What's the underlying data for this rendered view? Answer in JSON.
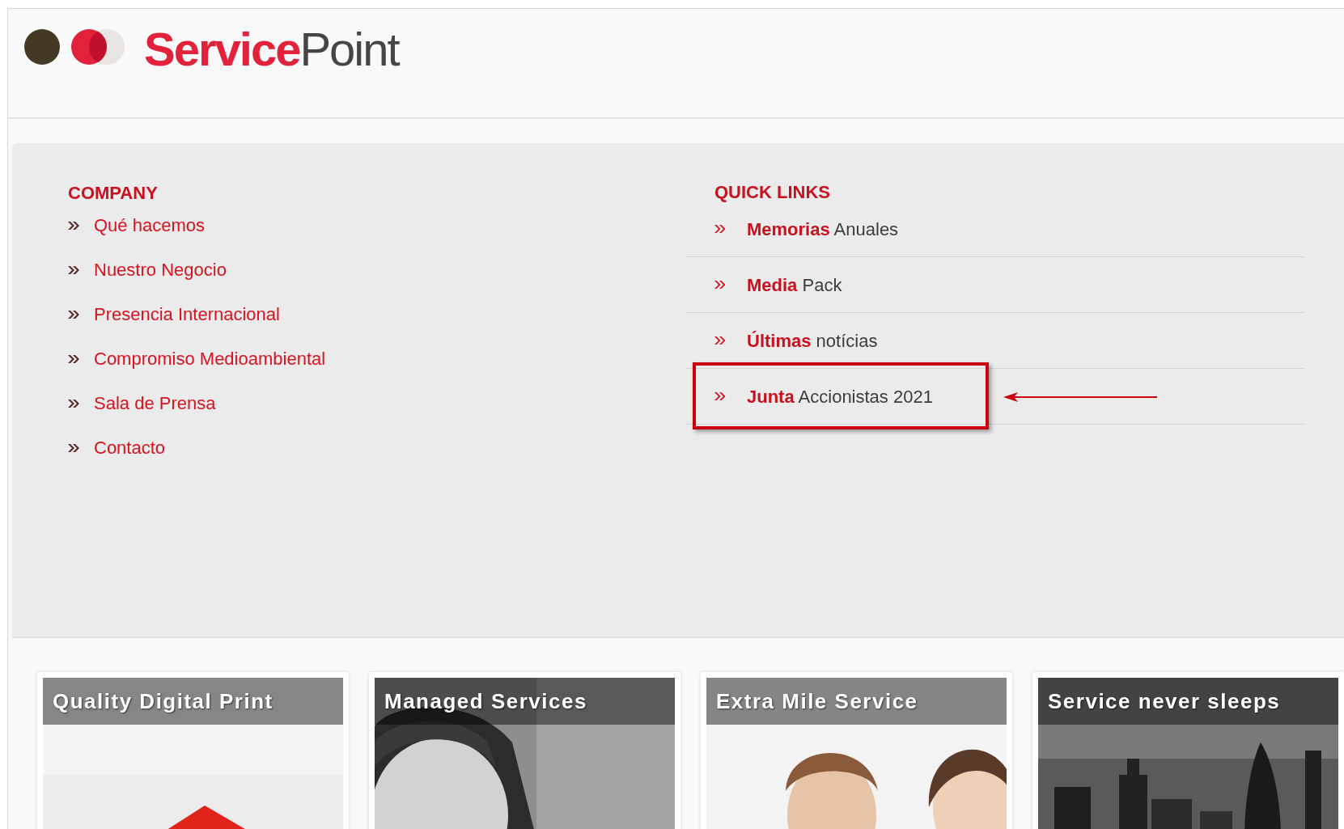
{
  "logo": {
    "primary": "Service",
    "secondary": "Point"
  },
  "company": {
    "heading": "COMPANY",
    "links": [
      "Qué hacemos",
      "Nuestro Negocio",
      "Presencia Internacional",
      "Compromiso Medioambiental",
      "Sala de Prensa",
      "Contacto"
    ]
  },
  "quick_links": {
    "heading": "QUICK LINKS",
    "items": [
      {
        "lead": "Memorias",
        "rest": "Anuales",
        "highlighted": false
      },
      {
        "lead": "Media",
        "rest": "Pack",
        "highlighted": false
      },
      {
        "lead": "Últimas",
        "rest": "notícias",
        "highlighted": false
      },
      {
        "lead": "Junta",
        "rest": "Accionistas 2021",
        "highlighted": true
      }
    ]
  },
  "cards": [
    {
      "title": "Quality Digital Print",
      "kind": "print"
    },
    {
      "title": "Managed Services",
      "kind": "person"
    },
    {
      "title": "Extra Mile Service",
      "kind": "team"
    },
    {
      "title": "Service never sleeps",
      "kind": "city"
    }
  ]
}
